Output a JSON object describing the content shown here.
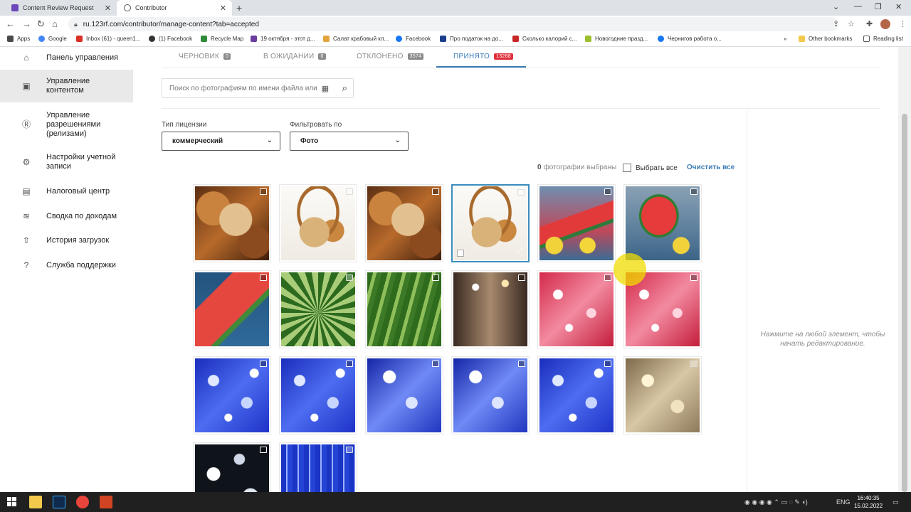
{
  "browser": {
    "tabs": [
      {
        "title": "Content Review Request",
        "close": "✕"
      },
      {
        "title": "Contributor",
        "close": "✕"
      }
    ],
    "new_tab": "+",
    "url": "ru.123rf.com/contributor/manage-content?tab=accepted",
    "bookmarks": [
      "Apps",
      "Google",
      "Inbox (61) - queen1...",
      "(1) Facebook",
      "Recycle Map",
      "19 октября - этот д...",
      "Салат крабовый кл...",
      "Facebook",
      "Про податок на до...",
      "Сколько калорий с...",
      "Новогодние празд...",
      "Чернигов работа о..."
    ],
    "other_bookmarks": "Other bookmarks",
    "reading_list": "Reading list",
    "chevron": "»"
  },
  "sidebar": {
    "items": [
      {
        "label": "Панель управления",
        "icon": "home-icon",
        "glyph": "⌂"
      },
      {
        "label": "Управление контентом",
        "icon": "image-icon",
        "glyph": "▣"
      },
      {
        "label": "Управление разрешениями (релизами)",
        "icon": "release-icon",
        "glyph": "Ⓡ"
      },
      {
        "label": "Настройки учетной записи",
        "icon": "gear-icon",
        "glyph": "⚙"
      },
      {
        "label": "Налоговый центр",
        "icon": "ledger-icon",
        "glyph": "▤"
      },
      {
        "label": "Сводка по доходам",
        "icon": "database-icon",
        "glyph": "≋"
      },
      {
        "label": "История загрузок",
        "icon": "upload-icon",
        "glyph": "⇧"
      },
      {
        "label": "Служба поддержки",
        "icon": "help-icon",
        "glyph": "?"
      }
    ]
  },
  "content_tabs": [
    {
      "label": "ЧЕРНОВИК",
      "count": "0"
    },
    {
      "label": "В ОЖИДАНИИ",
      "count": "0"
    },
    {
      "label": "ОТКЛОНЕНО",
      "count": "3574"
    },
    {
      "label": "ПРИНЯТО",
      "count": "13268"
    }
  ],
  "search": {
    "placeholder": "Поиск по фотографиям по имени файла или"
  },
  "filters": {
    "license_label": "Тип лицензии",
    "license_value": "коммерческий",
    "filter_label": "Фильтровать по",
    "filter_value": "Фото"
  },
  "selection": {
    "count": "0",
    "text": "фотографии выбраны",
    "select_all": "Выбрать все",
    "clear_all": "Очистить все"
  },
  "hint": "Нажмите на любой элемент, чтобы начать редактирование.",
  "thumbnails": [
    "bread1",
    "bread2",
    "bread1",
    "bread2",
    "water1",
    "water2",
    "water3",
    "stripes",
    "melon",
    "street",
    "pink",
    "pink",
    "blue",
    "blue",
    "blue2",
    "blue2",
    "blue",
    "gold",
    "dark",
    "bluestripe"
  ],
  "taskbar": {
    "time": "16:40:35",
    "date": "15.02.2022",
    "lang": "ENG"
  },
  "colors": {
    "accent": "#3b7ab6",
    "badge_active": "#e0303a",
    "sidebar_active": "#e9e9e9"
  }
}
